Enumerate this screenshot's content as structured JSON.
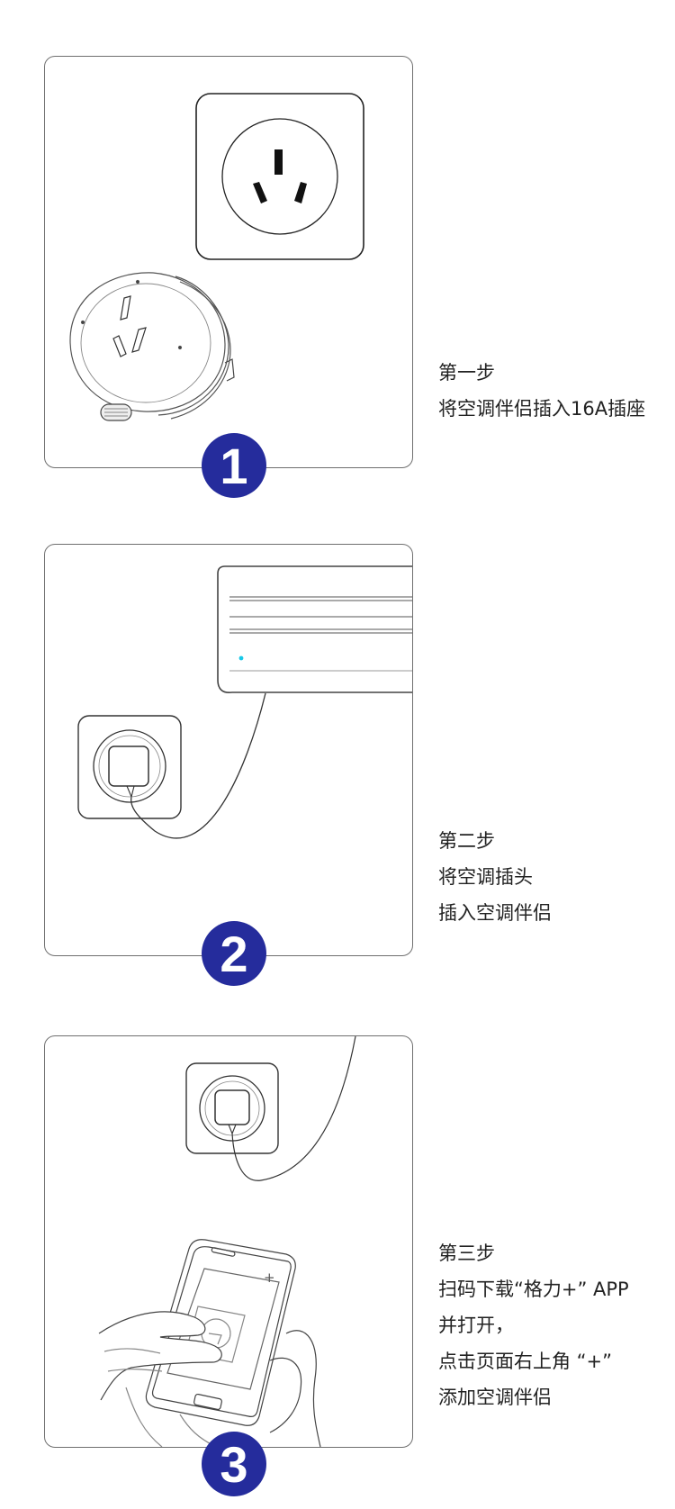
{
  "steps": [
    {
      "number": "1",
      "lines": [
        "第一步",
        "将空调伴侣插入16A插座"
      ]
    },
    {
      "number": "2",
      "lines": [
        "第二步",
        "将空调插头",
        "插入空调伴侣"
      ]
    },
    {
      "number": "3",
      "lines": [
        "第三步",
        "扫码下载“格力+” APP",
        "并打开，",
        "点击页面右上角 “+”",
        "添加空调伴侣"
      ]
    }
  ],
  "colors": {
    "badge": "#252c9c",
    "panel_border": "#6f6f6f",
    "text": "#222222"
  },
  "icons": [
    "wall-socket-icon",
    "companion-plug-icon",
    "air-conditioner-icon",
    "plug-cable-icon",
    "smartphone-hand-icon"
  ]
}
